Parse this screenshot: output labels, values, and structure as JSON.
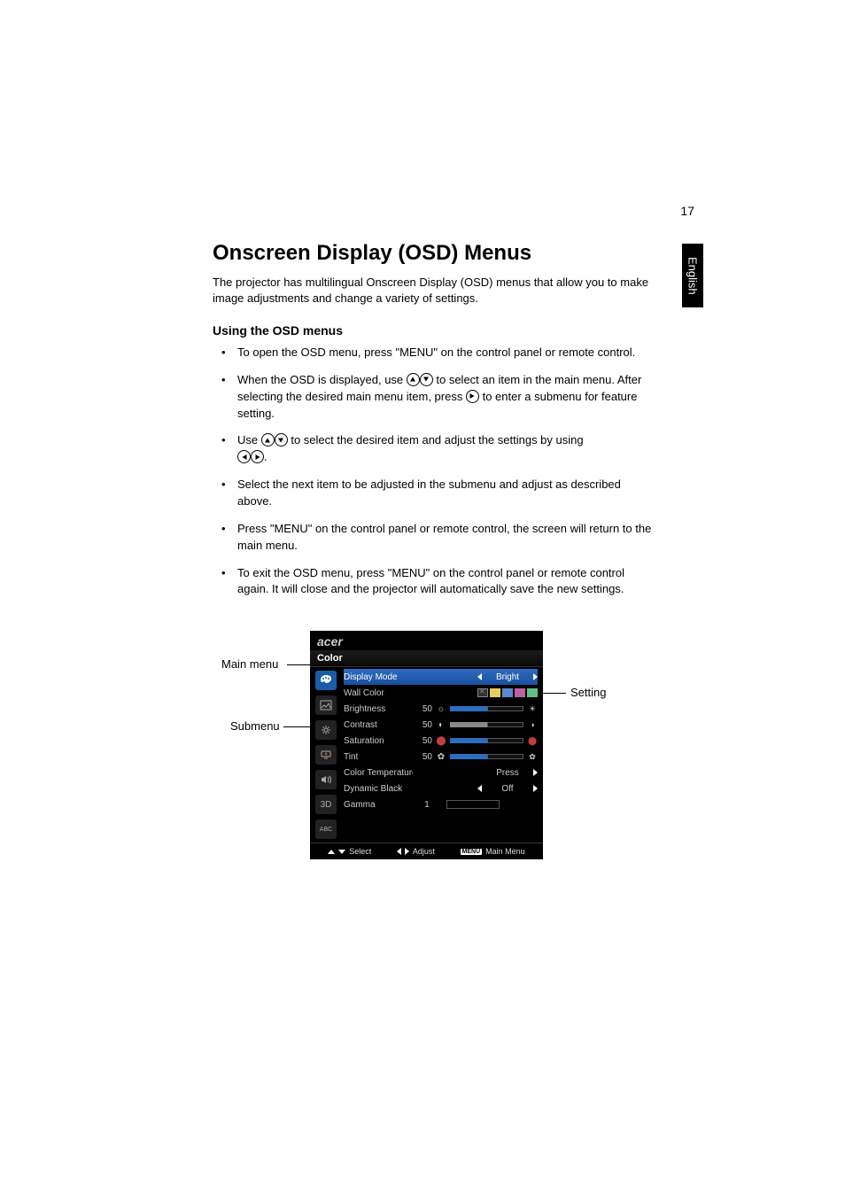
{
  "page_number": "17",
  "language_tab": "English",
  "heading": "Onscreen Display (OSD) Menus",
  "intro": "The projector has multilingual Onscreen Display (OSD) menus that allow you to make image adjustments and change a variety of settings.",
  "subheading": "Using the OSD menus",
  "bullets": {
    "b1": "To open the OSD menu, press \"MENU\" on the control panel or remote control.",
    "b2a": "When the OSD is displayed, use ",
    "b2b": " to select an item in the main menu. After selecting the desired main menu item, press ",
    "b2c": " to enter a submenu for feature setting.",
    "b3a": "Use ",
    "b3b": " to select the desired item and adjust the settings by using ",
    "b3c": ".",
    "b4": "Select the next item to be adjusted in the submenu and adjust as described above.",
    "b5": "Press \"MENU\" on the control panel or remote control, the screen will return to the main menu.",
    "b6": "To exit the OSD menu, press \"MENU\" on the control panel or remote control again. It will close and the projector will automatically save the new settings."
  },
  "callouts": {
    "main_menu": "Main menu",
    "submenu": "Submenu",
    "setting": "Setting"
  },
  "osd": {
    "brand": "acer",
    "title": "Color",
    "icons": {
      "color": "color-icon",
      "image": "image-icon",
      "setting": "setting-icon",
      "management": "management-icon",
      "audio": "audio-icon",
      "threeD": "3D",
      "language": "ABC"
    },
    "rows": {
      "display_mode": {
        "label": "Display Mode",
        "value": "Bright"
      },
      "wall_color": {
        "label": "Wall Color"
      },
      "brightness": {
        "label": "Brightness",
        "num": "50"
      },
      "contrast": {
        "label": "Contrast",
        "num": "50"
      },
      "saturation": {
        "label": "Saturation",
        "num": "50"
      },
      "tint": {
        "label": "Tint",
        "num": "50"
      },
      "color_temp": {
        "label": "Color Temperature",
        "value": "Press"
      },
      "dyn_black": {
        "label": "Dynamic Black",
        "value": "Off"
      },
      "gamma": {
        "label": "Gamma",
        "num": "1"
      }
    },
    "footer": {
      "select": "Select",
      "adjust": "Adjust",
      "menu_key": "MENU",
      "main_menu": "Main Menu"
    }
  }
}
